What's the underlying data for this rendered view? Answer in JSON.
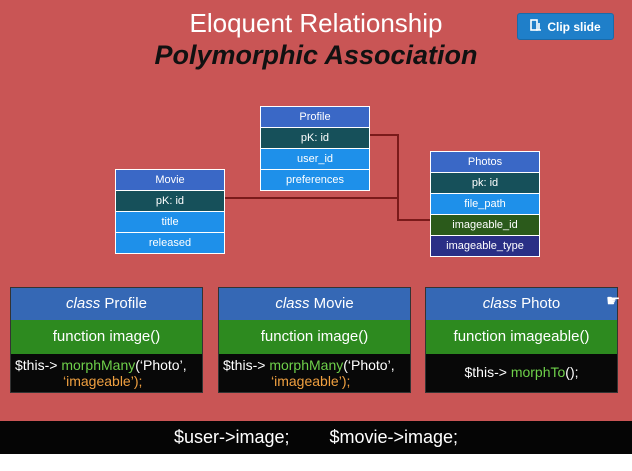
{
  "slide": {
    "title1": "Eloquent Relationship",
    "title2": "Polymorphic Association"
  },
  "clip_button": {
    "label": "Clip slide",
    "icon": "clip-icon"
  },
  "tables": {
    "profile": {
      "header": "Profile",
      "rows": [
        "pK: id",
        "user_id",
        "preferences"
      ]
    },
    "movie": {
      "header": "Movie",
      "rows": [
        "pK: id",
        "title",
        "released"
      ]
    },
    "photos": {
      "header": "Photos",
      "rows": [
        "pk: id",
        "file_path",
        "imageable_id",
        "imageable_type"
      ]
    }
  },
  "cards": [
    {
      "class_kw": "class",
      "class_name": "Profile",
      "func": "function image()",
      "code1": "$this->",
      "code1m": "morphMany",
      "code1s": "(‘Photo’,",
      "code2": "‘imageable’);"
    },
    {
      "class_kw": "class",
      "class_name": "Movie",
      "func": "function image()",
      "code1": "$this->",
      "code1m": "morphMany",
      "code1s": "(‘Photo’,",
      "code2": "‘imageable’);"
    },
    {
      "class_kw": "class",
      "class_name": "Photo",
      "func": "function imageable()",
      "code1": "$this->",
      "code1m": "morphTo",
      "code1s": "();",
      "code2": ""
    }
  ],
  "bottom": {
    "left": "$user->image;",
    "right": "$movie->image;"
  },
  "colors": {
    "slide_bg": "#c95555",
    "relation_line": "#7a1a1a"
  }
}
